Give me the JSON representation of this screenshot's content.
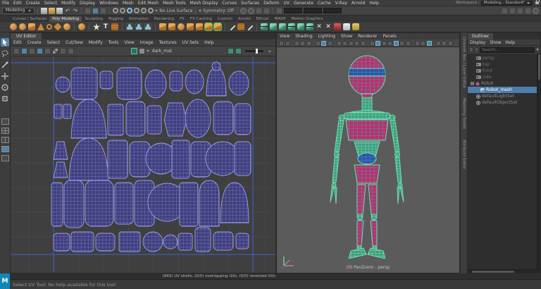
{
  "branding": {
    "logo_letter": "M"
  },
  "app": {
    "workspace_label": "Workspace :",
    "workspace_value": "Modeling - Standard*"
  },
  "menu_bar": {
    "items": [
      "File",
      "Edit",
      "Create",
      "Select",
      "Modify",
      "Display",
      "Windows",
      "Mesh",
      "Edit Mesh",
      "Mesh Tools",
      "Mesh Display",
      "Curves",
      "Surfaces",
      "Deform",
      "UV",
      "Generate",
      "Cache",
      "V-Ray",
      "Arnold",
      "Help"
    ]
  },
  "status_line": {
    "mode": "Modeling",
    "no_live_surface": "No Live Surface",
    "symmetry": "Symmetry: Off"
  },
  "shelf": {
    "tabs": [
      "Curves / Surfaces",
      "Poly Modeling",
      "Sculpting",
      "Rigging",
      "Animation",
      "Rendering",
      "FX",
      "FX Caching",
      "Custom",
      "Arnold",
      "Bifrost",
      "MASH",
      "Motion Graphics"
    ],
    "active_tab": "Poly Modeling",
    "type_tool_glyph": "T",
    "cut_glyph": "✕"
  },
  "uv_editor": {
    "title": "UV Editor",
    "menus": [
      "Edit",
      "Create",
      "Select",
      "Cut/Sew",
      "Modify",
      "Tools",
      "View",
      "Image",
      "Textures",
      "UV Sets",
      "Help"
    ],
    "material_name": "dark_mat",
    "more_glyph": "»",
    "status_text": "(665) UV shells, (0/0) overlapping UVs, (0/0) reversed UVs"
  },
  "viewport": {
    "menus": [
      "View",
      "Shading",
      "Lighting",
      "Show",
      "Renderer",
      "Panels"
    ],
    "camera_label": "(0) PanZoom - persp"
  },
  "side_tabs": [
    "Channel Box / Layer Editor",
    "Modeling Toolkit",
    "Attribute Editor"
  ],
  "outliner": {
    "title": "Outliner",
    "menus": [
      "Display",
      "Show",
      "Help"
    ],
    "search_placeholder": "Search...",
    "items": [
      {
        "label": "persp"
      },
      {
        "label": "top"
      },
      {
        "label": "front"
      },
      {
        "label": "side"
      },
      {
        "label": "Robot"
      },
      {
        "label": "Robot_mesh",
        "selected": true
      },
      {
        "label": "defaultLightSet"
      },
      {
        "label": "defaultObjectSet"
      }
    ]
  },
  "help_line": {
    "text": "Select UV Tool: No help available for this tool"
  },
  "colors": {
    "accent_blue": "#5285a6",
    "selection_blue": "#4f7cac",
    "shelf_icon_orange": "#cf8836",
    "uv_shell_stroke": "#9d9dea",
    "uv_axis_blue": "#3f5fae",
    "mesh_pink": "#b92f74",
    "mesh_green": "#5fd6a2",
    "mesh_band_blue": "#3452b0",
    "viewport_bg": "#5b5b5b"
  }
}
